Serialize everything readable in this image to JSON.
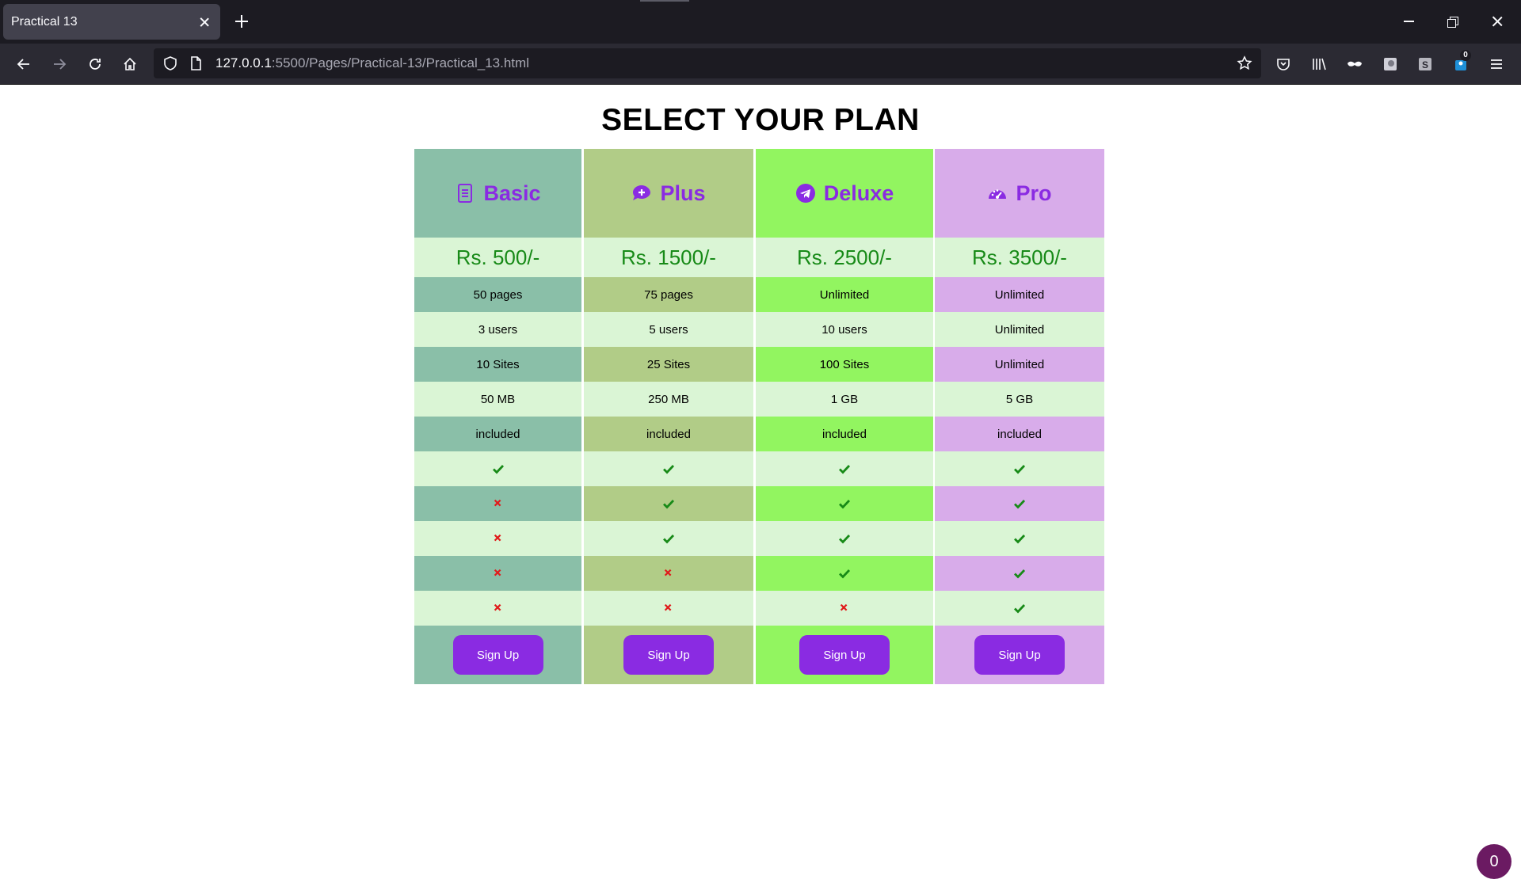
{
  "browser": {
    "tab_title": "Practical 13",
    "url_host": "127.0.0.1",
    "url_rest": ":5500/Pages/Practical-13/Practical_13.html",
    "extension_badge": "0"
  },
  "page": {
    "title": "SELECT YOUR PLAN",
    "fab_count": "0"
  },
  "colors": {
    "basic": "#8abfa8",
    "plus": "#b1cc87",
    "deluxe": "#92f560",
    "pro": "#d8acea",
    "row_light": "#daf5d5",
    "accent": "#8a2be2",
    "check": "#178a17",
    "cross": "#e01b1b"
  },
  "plans": [
    {
      "name": "Basic",
      "icon": "file-invoice-icon",
      "price": "Rs. 500/-",
      "features": [
        "50 pages",
        "3 users",
        "10 Sites",
        "50 MB",
        "included"
      ],
      "checks": [
        true,
        false,
        false,
        false,
        false
      ],
      "cta": "Sign Up"
    },
    {
      "name": "Plus",
      "icon": "comment-plus-icon",
      "price": "Rs. 1500/-",
      "features": [
        "75 pages",
        "5 users",
        "25 Sites",
        "250 MB",
        "included"
      ],
      "checks": [
        true,
        true,
        true,
        false,
        false
      ],
      "cta": "Sign Up"
    },
    {
      "name": "Deluxe",
      "icon": "telegram-icon",
      "price": "Rs. 2500/-",
      "features": [
        "Unlimited",
        "10 users",
        "100 Sites",
        "1 GB",
        "included"
      ],
      "checks": [
        true,
        true,
        true,
        true,
        false
      ],
      "cta": "Sign Up"
    },
    {
      "name": "Pro",
      "icon": "tachometer-icon",
      "price": "Rs. 3500/-",
      "features": [
        "Unlimited",
        "Unlimited",
        "Unlimited",
        "5 GB",
        "included"
      ],
      "checks": [
        true,
        true,
        true,
        true,
        true
      ],
      "cta": "Sign Up"
    }
  ]
}
